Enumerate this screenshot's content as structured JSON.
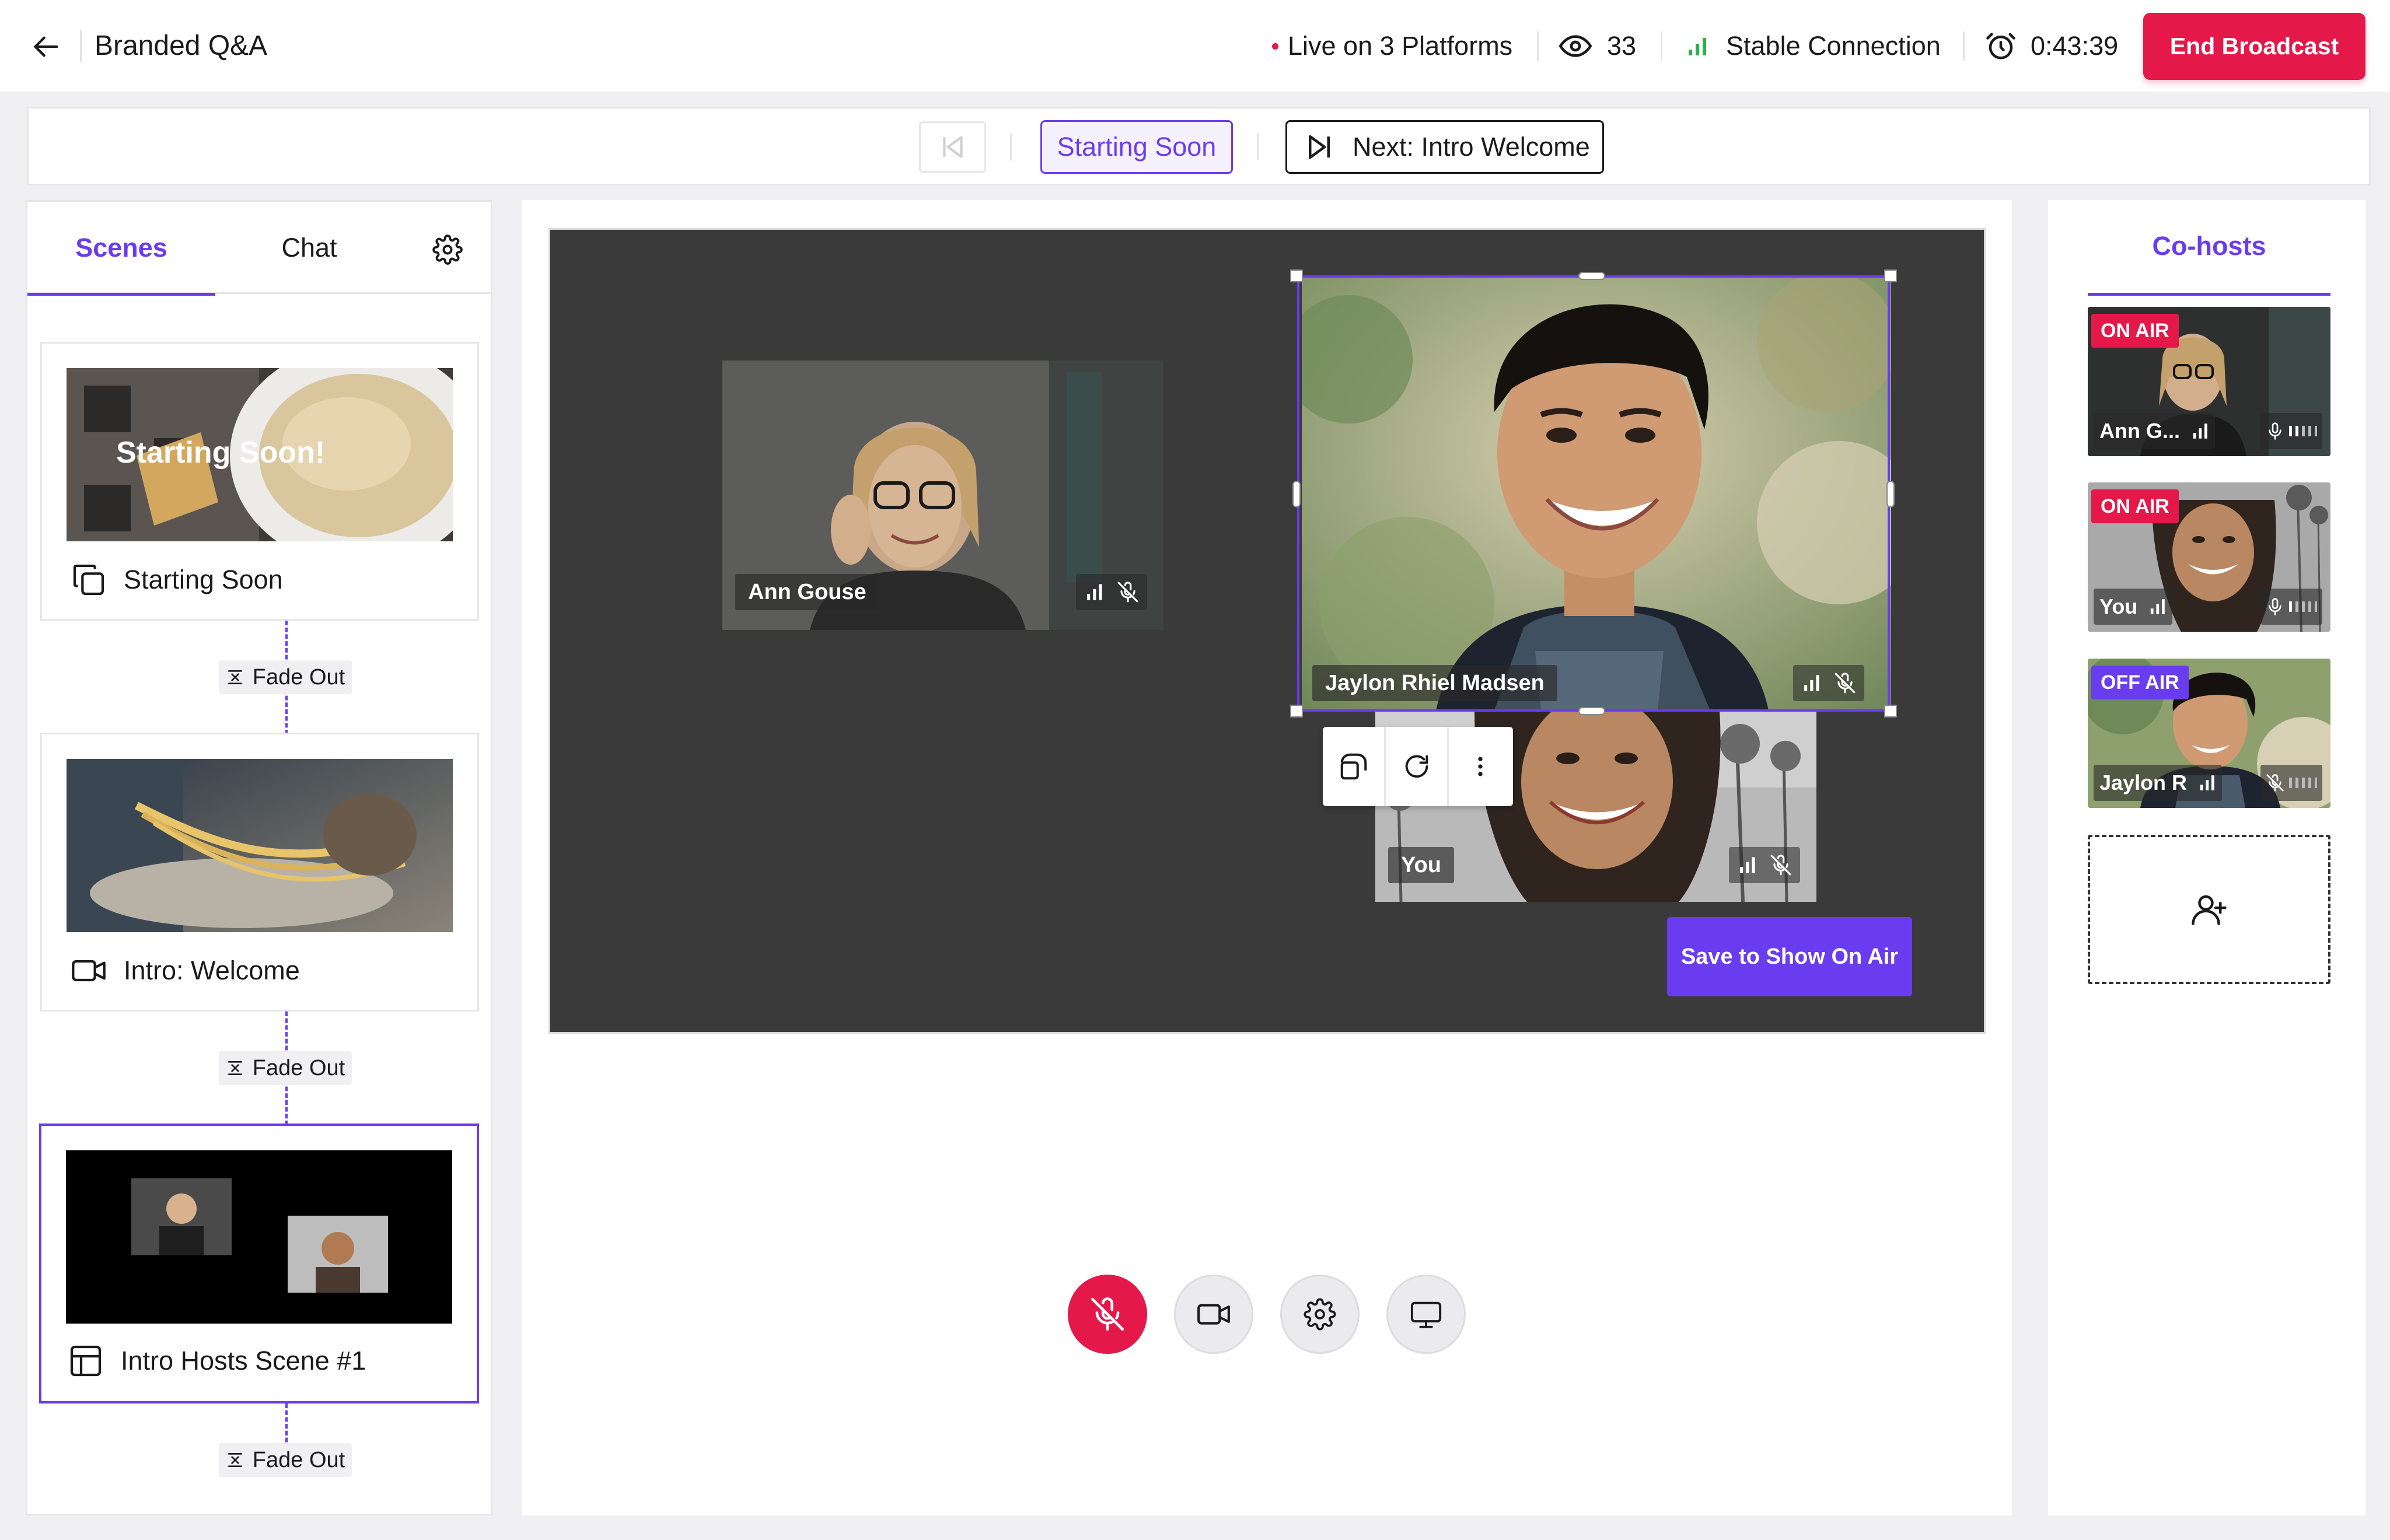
{
  "header": {
    "title": "Branded Q&A",
    "live_status": "Live on 3 Platforms",
    "viewer_count": "33",
    "connection_status": "Stable Connection",
    "elapsed_time": "0:43:39",
    "end_button_label": "End Broadcast"
  },
  "scene_nav": {
    "current_scene": "Starting Soon",
    "next_scene": "Next: Intro Welcome"
  },
  "left_panel": {
    "tabs": [
      {
        "label": "Scenes",
        "active": true
      },
      {
        "label": "Chat",
        "active": false
      }
    ],
    "scenes": [
      {
        "label": "Starting Soon",
        "thumb_overlay": "Starting Soon!",
        "icon": "copy-icon",
        "transition": "Fade Out"
      },
      {
        "label": "Intro: Welcome",
        "icon": "video-icon",
        "transition": "Fade Out"
      },
      {
        "label": "Intro Hosts Scene #1",
        "icon": "layout-icon",
        "transition": "Fade Out",
        "active": true
      }
    ]
  },
  "stage": {
    "tiles": [
      {
        "name": "Ann Gouse"
      },
      {
        "name": "Jaylon Rhiel Madsen",
        "selected": true
      },
      {
        "name": "You"
      }
    ],
    "save_button_label": "Save to Show On Air"
  },
  "controls": [
    "mic-muted-icon",
    "camera-icon",
    "settings-icon",
    "screen-share-icon"
  ],
  "right_panel": {
    "tab_label": "Co-hosts",
    "cohosts": [
      {
        "name": "Ann G...",
        "status": "ON AIR"
      },
      {
        "name": "You",
        "status": "ON AIR"
      },
      {
        "name": "Jaylon R",
        "status": "OFF AIR"
      }
    ]
  },
  "colors": {
    "accent": "#6a3cf0",
    "danger": "#e5184a",
    "connection_good": "#2bb24c",
    "stage_bg": "#3a3a3a"
  }
}
